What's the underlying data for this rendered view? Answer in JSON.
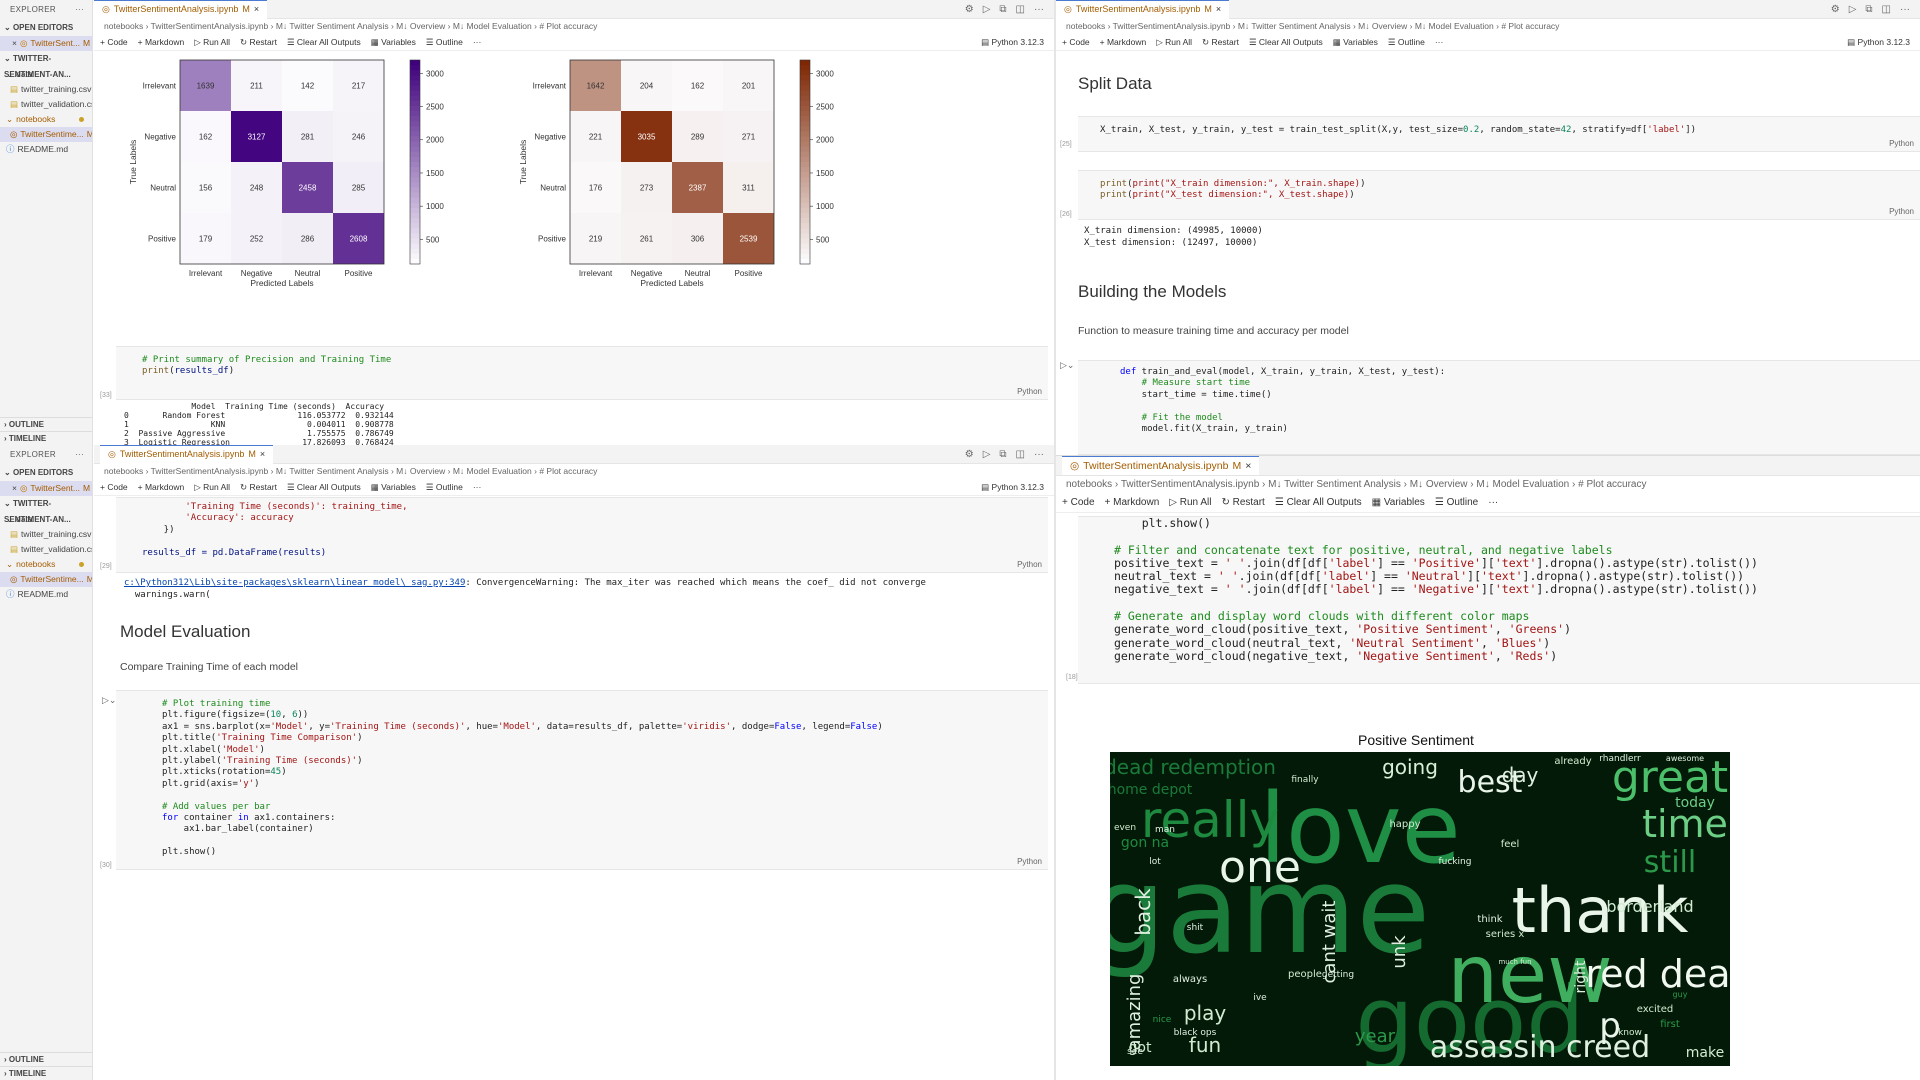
{
  "explorer": {
    "title": "EXPLORER",
    "open_editors": "OPEN EDITORS",
    "open_file": "TwitterSent...",
    "open_file_status": "M",
    "project": "TWITTER-SENTIMENT-AN...",
    "folders": [
      {
        "name": "data",
        "files": [
          "twitter_training.csv",
          "twitter_validation.csv"
        ]
      },
      {
        "name": "notebooks",
        "files": [
          "TwitterSentime..."
        ]
      }
    ],
    "readme": "README.md",
    "outline": "OUTLINE",
    "timeline": "TIMELINE"
  },
  "editor": {
    "tab_title": "TwitterSentimentAnalysis.ipynb",
    "tab_status": "M",
    "breadcrumb": [
      "notebooks",
      "TwitterSentimentAnalysis.ipynb",
      "M↓ Twitter Sentiment Analysis",
      "M↓ Overview",
      "M↓ Model Evaluation",
      "# Plot accuracy"
    ],
    "toolbar": {
      "code": "+ Code",
      "markdown": "+ Markdown",
      "run_all": "▷ Run All",
      "restart": "↻ Restart",
      "clear": "Clear All Outputs",
      "variables": "Variables",
      "outline": "Outline",
      "more": "···",
      "kernel": "Python 3.12.3"
    },
    "language": "Python"
  },
  "pane_top_left": {
    "matrix_left": {
      "ylabel": "True Labels",
      "xlabel": "Predicted Labels",
      "labels": [
        "Irrelevant",
        "Negative",
        "Neutral",
        "Positive"
      ],
      "values": [
        [
          1639,
          211,
          142,
          217
        ],
        [
          162,
          3127,
          281,
          246
        ],
        [
          156,
          248,
          2458,
          285
        ],
        [
          179,
          252,
          286,
          2608
        ]
      ],
      "colorbar_ticks": [
        3000,
        2500,
        2000,
        1500,
        1000,
        500
      ],
      "color": "#3f007d"
    },
    "matrix_right": {
      "ylabel": "True Labels",
      "xlabel": "Predicted Labels",
      "labels": [
        "Irrelevant",
        "Negative",
        "Neutral",
        "Positive"
      ],
      "values": [
        [
          1642,
          204,
          162,
          201
        ],
        [
          221,
          3035,
          289,
          271
        ],
        [
          176,
          273,
          2387,
          311
        ],
        [
          219,
          261,
          306,
          2539
        ]
      ],
      "colorbar_ticks": [
        3000,
        2500,
        2000,
        1500,
        1000,
        500
      ],
      "color": "#7f2704"
    },
    "cell_num": "[33]",
    "code_comment": "# Print summary of Precision and Training Time",
    "code_line": "print(results_df)",
    "output_header": "              Model  Training Time (seconds)  Accuracy",
    "output_rows": [
      "0       Random Forest               116.053772  0.932144",
      "1                 KNN                 0.004011  0.908778",
      "2  Passive Aggressive                 1.755575  0.786749",
      "3  Logistic Regression               17.826093  0.768424"
    ]
  },
  "pane_bottom_left": {
    "code_lines": [
      "        'Training Time (seconds)': training_time,",
      "        'Accuracy': accuracy",
      "    })",
      "",
      "results_df = pd.DataFrame(results)"
    ],
    "cell_num": "[29]",
    "warning_link": "c:\\Python312\\Lib\\site-packages\\sklearn\\linear_model\\_sag.py:349",
    "warning_text": ": ConvergenceWarning: The max_iter was reached which means the coef_ did not converge",
    "warning_line2": "  warnings.warn(",
    "heading": "Model Evaluation",
    "subtext": "Compare Training Time of each model",
    "plot_code": [
      "# Plot training time",
      "plt.figure(figsize=(10, 6))",
      "ax1 = sns.barplot(x='Model', y='Training Time (seconds)', hue='Model', data=results_df, palette='viridis', dodge=False, legend=False)",
      "plt.title('Training Time Comparison')",
      "plt.xlabel('Model')",
      "plt.ylabel('Training Time (seconds)')",
      "plt.xticks(rotation=45)",
      "plt.grid(axis='y')",
      "",
      "# Add values per bar",
      "for container in ax1.containers:",
      "    ax1.bar_label(container)",
      "",
      "plt.show()"
    ],
    "plot_cell_num": "[30]"
  },
  "pane_top_right": {
    "split_heading": "Split Data",
    "split_code": "X_train, X_test, y_train, y_test = train_test_split(X,y, test_size=0.2, random_state=42, stratify=df['label'])",
    "split_num": "[25]",
    "print_code": [
      "print(\"X_train dimension:\", X_train.shape)",
      "print(\"X_test dimension:\", X_test.shape)"
    ],
    "print_num": "[26]",
    "print_out": [
      "X_train dimension: (49985, 10000)",
      "X_test dimension: (12497, 10000)"
    ],
    "build_heading": "Building the Models",
    "build_text": "Function to measure training time and accuracy per model",
    "func_code": [
      "def train_and_eval(model, X_train, y_train, X_test, y_test):",
      "    # Measure start time",
      "    start_time = time.time()",
      "",
      "    # Fit the model",
      "    model.fit(X_train, y_train)"
    ]
  },
  "pane_bottom_right": {
    "code_lines": [
      "    plt.show()",
      "",
      "# Filter and concatenate text for positive, neutral, and negative labels",
      "positive_text = ' '.join(df[df['label'] == 'Positive']['text'].dropna().astype(str).tolist())",
      "neutral_text = ' '.join(df[df['label'] == 'Neutral']['text'].dropna().astype(str).tolist())",
      "negative_text = ' '.join(df[df['label'] == 'Negative']['text'].dropna().astype(str).tolist())",
      "",
      "# Generate and display word clouds with different color maps",
      "generate_word_cloud(positive_text, 'Positive Sentiment', 'Greens')",
      "generate_word_cloud(neutral_text, 'Neutral Sentiment', 'Blues')",
      "generate_word_cloud(negative_text, 'Negative Sentiment', 'Reds')"
    ],
    "cell_num": "[18]",
    "wordcloud_title": "Positive Sentiment",
    "words": [
      {
        "t": "game",
        "s": 120,
        "c": "#1a7a3a"
      },
      {
        "t": "love",
        "s": 96,
        "c": "#1f8f45"
      },
      {
        "t": "good",
        "s": 92,
        "c": "#156a30"
      },
      {
        "t": "new",
        "s": 80,
        "c": "#3fae5f"
      },
      {
        "t": "thank",
        "s": 62,
        "c": "#e8f5e8"
      },
      {
        "t": "really",
        "s": 50,
        "c": "#1d8a40"
      },
      {
        "t": "great",
        "s": 44,
        "c": "#4cbf6a"
      },
      {
        "t": "one",
        "s": 44,
        "c": "#e8f5e8"
      },
      {
        "t": "time",
        "s": 38,
        "c": "#6ccf85"
      },
      {
        "t": "red dead",
        "s": 38,
        "c": "#f0f8f0"
      },
      {
        "t": "assassin creed",
        "s": 30,
        "c": "#e0f0e0"
      },
      {
        "t": "best",
        "s": 30,
        "c": "#e8f5e8"
      },
      {
        "t": "still",
        "s": 30,
        "c": "#2a9a4a"
      },
      {
        "t": "going",
        "s": 20,
        "c": "#d8f0d8"
      },
      {
        "t": "day",
        "s": 20,
        "c": "#e0f0e0"
      },
      {
        "t": "play",
        "s": 20,
        "c": "#d0ecd0"
      },
      {
        "t": "fun",
        "s": 20,
        "c": "#d0ecd0"
      },
      {
        "t": "dead redemption",
        "s": 20,
        "c": "#1a7a3a"
      },
      {
        "t": "back",
        "s": 20,
        "c": "#e0f0e0"
      },
      {
        "t": "amazing",
        "s": 18,
        "c": "#e0f0e0"
      },
      {
        "t": "cant wait",
        "s": 18,
        "c": "#e0f0e0"
      },
      {
        "t": "borderland",
        "s": 16,
        "c": "#d0ecd0"
      },
      {
        "t": "unk",
        "s": 18,
        "c": "#e0f0e0"
      },
      {
        "t": "year",
        "s": 18,
        "c": "#2a9a4a"
      },
      {
        "t": "p",
        "s": 34,
        "c": "#e8f5e8"
      },
      {
        "t": "make",
        "s": 14,
        "c": "#d0ecd0"
      },
      {
        "t": "today",
        "s": 14,
        "c": "#6ccf85"
      },
      {
        "t": "got",
        "s": 14,
        "c": "#d0ecd0"
      },
      {
        "t": "happy",
        "s": 10,
        "c": "#d0ecd0"
      },
      {
        "t": "home depot",
        "s": 14,
        "c": "#1a7a3a"
      },
      {
        "t": "right",
        "s": 14,
        "c": "#e0f0e0"
      },
      {
        "t": "feel",
        "s": 10,
        "c": "#d0ecd0"
      },
      {
        "t": "always",
        "s": 10,
        "c": "#e0f0e0"
      },
      {
        "t": "people",
        "s": 10,
        "c": "#d0ecd0"
      },
      {
        "t": "series x",
        "s": 10,
        "c": "#d0ecd0"
      },
      {
        "t": "excited",
        "s": 10,
        "c": "#d0ecd0"
      },
      {
        "t": "first",
        "s": 10,
        "c": "#2a9a4a"
      },
      {
        "t": "already",
        "s": 10,
        "c": "#d0ecd0"
      },
      {
        "t": "rhandlerr",
        "s": 9,
        "c": "#e0f0e0"
      },
      {
        "t": "awesome",
        "s": 8,
        "c": "#e0f0e0"
      },
      {
        "t": "finally",
        "s": 9,
        "c": "#d0ecd0"
      },
      {
        "t": "gon na",
        "s": 14,
        "c": "#1d8a40"
      },
      {
        "t": "lot",
        "s": 9,
        "c": "#e0f0e0"
      },
      {
        "t": "even",
        "s": 9,
        "c": "#d0ecd0"
      },
      {
        "t": "man",
        "s": 9,
        "c": "#e0f0e0"
      },
      {
        "t": "shit",
        "s": 9,
        "c": "#e0f0e0"
      },
      {
        "t": "black ops",
        "s": 9,
        "c": "#e0f0e0"
      },
      {
        "t": "nice",
        "s": 9,
        "c": "#2a9a4a"
      },
      {
        "t": "see",
        "s": 9,
        "c": "#e0f0e0"
      },
      {
        "t": "getting",
        "s": 9,
        "c": "#e0f0e0"
      },
      {
        "t": "think",
        "s": 10,
        "c": "#e0f0e0"
      },
      {
        "t": "ive",
        "s": 9,
        "c": "#e0f0e0"
      },
      {
        "t": "know",
        "s": 9,
        "c": "#d0ecd0"
      },
      {
        "t": "guy",
        "s": 8,
        "c": "#2a9a4a"
      },
      {
        "t": "fucking",
        "s": 9,
        "c": "#e0f0e0"
      },
      {
        "t": "much fun",
        "s": 7,
        "c": "#d0ecd0"
      }
    ]
  }
}
